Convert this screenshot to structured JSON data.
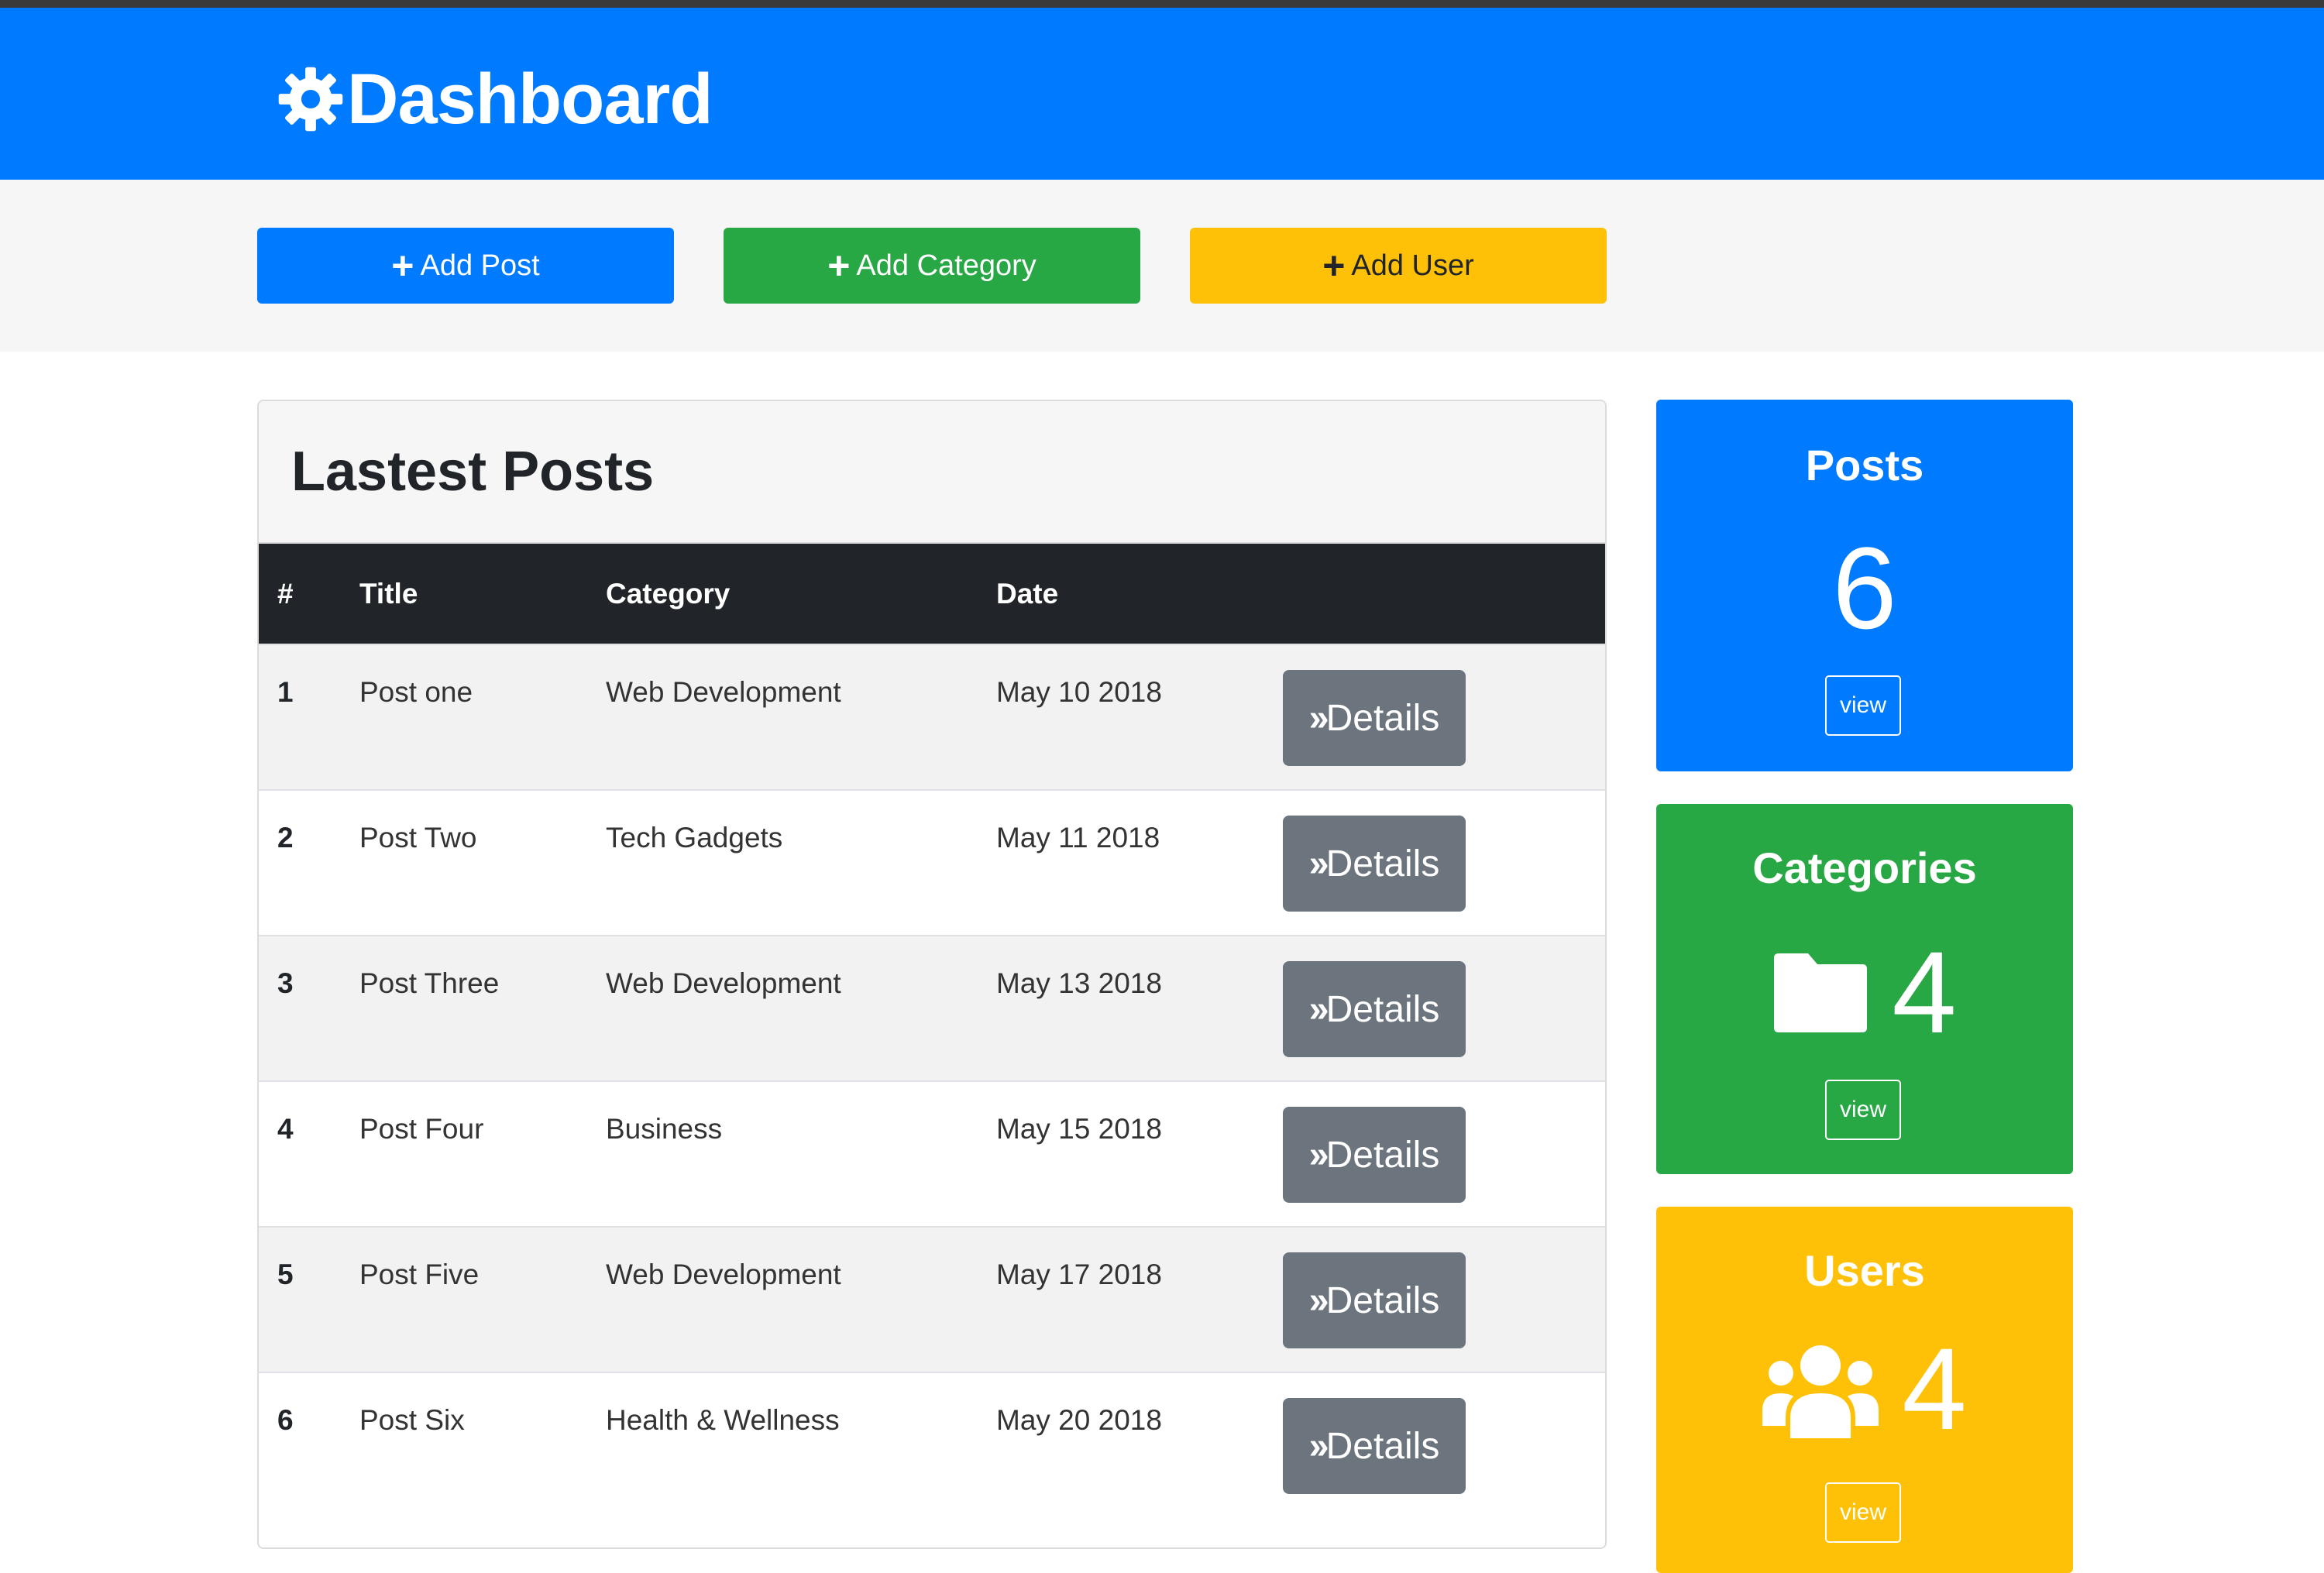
{
  "header": {
    "brand_icon": "gear-icon",
    "brand_title": "Dashboard",
    "color": "#007bff"
  },
  "actions": {
    "add_post": "Add Post",
    "add_category": "Add Category",
    "add_user": "Add User"
  },
  "posts_card": {
    "title": "Lastest Posts",
    "columns": [
      "#",
      "Title",
      "Category",
      "Date"
    ],
    "rows": [
      {
        "num": "1",
        "title": "Post one",
        "category": "Web Development",
        "date": "May 10 2018",
        "action": "Details"
      },
      {
        "num": "2",
        "title": "Post Two",
        "category": "Tech Gadgets",
        "date": "May 11 2018",
        "action": "Details"
      },
      {
        "num": "3",
        "title": "Post Three",
        "category": "Web Development",
        "date": "May 13 2018",
        "action": "Details"
      },
      {
        "num": "4",
        "title": "Post Four",
        "category": "Business",
        "date": "May 15 2018",
        "action": "Details"
      },
      {
        "num": "5",
        "title": "Post Five",
        "category": "Web Development",
        "date": "May 17 2018",
        "action": "Details"
      },
      {
        "num": "6",
        "title": "Post Six",
        "category": "Health & Wellness",
        "date": "May 20 2018",
        "action": "Details"
      }
    ]
  },
  "stats": {
    "posts": {
      "title": "Posts",
      "value": "6",
      "view": "view",
      "color": "#007bff"
    },
    "categories": {
      "title": "Categories",
      "value": "4",
      "icon": "folder-icon",
      "view": "view",
      "color": "#28a745"
    },
    "users": {
      "title": "Users",
      "value": "4",
      "icon": "users-icon",
      "view": "view",
      "color": "#ffc107"
    }
  }
}
